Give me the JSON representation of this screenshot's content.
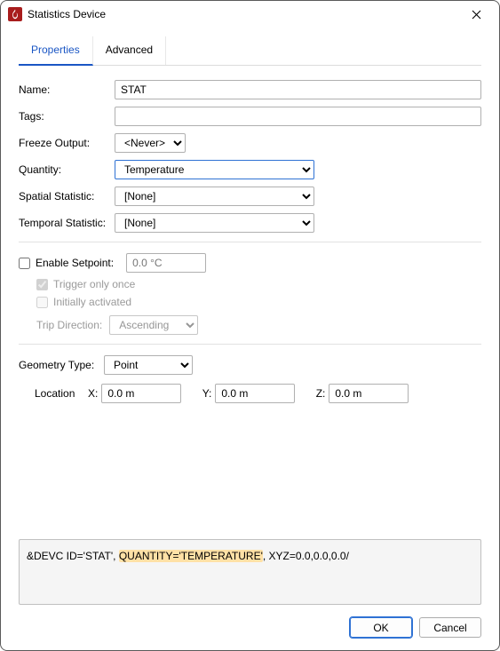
{
  "window": {
    "title": "Statistics Device"
  },
  "tabs": {
    "properties": "Properties",
    "advanced": "Advanced"
  },
  "form": {
    "name_label": "Name:",
    "name_value": "STAT",
    "tags_label": "Tags:",
    "tags_value": "",
    "freeze_label": "Freeze Output:",
    "freeze_value": "<Never>",
    "quantity_label": "Quantity:",
    "quantity_value": "Temperature",
    "spatial_label": "Spatial Statistic:",
    "spatial_value": "[None]",
    "temporal_label": "Temporal Statistic:",
    "temporal_value": "[None]"
  },
  "setpoint": {
    "enable_label": "Enable Setpoint:",
    "placeholder": "0.0 °C",
    "trigger_label": "Trigger only once",
    "initially_label": "Initially activated",
    "trip_label": "Trip Direction:",
    "trip_value": "Ascending"
  },
  "geometry": {
    "type_label": "Geometry Type:",
    "type_value": "Point",
    "location_label": "Location",
    "x_label": "X:",
    "x_value": "0.0 m",
    "y_label": "Y:",
    "y_value": "0.0 m",
    "z_label": "Z:",
    "z_value": "0.0 m"
  },
  "code": {
    "pre": "&DEVC ID='STAT', ",
    "hl": "QUANTITY='TEMPERATURE'",
    "post": ", XYZ=0.0,0.0,0.0/"
  },
  "buttons": {
    "ok": "OK",
    "cancel": "Cancel"
  }
}
